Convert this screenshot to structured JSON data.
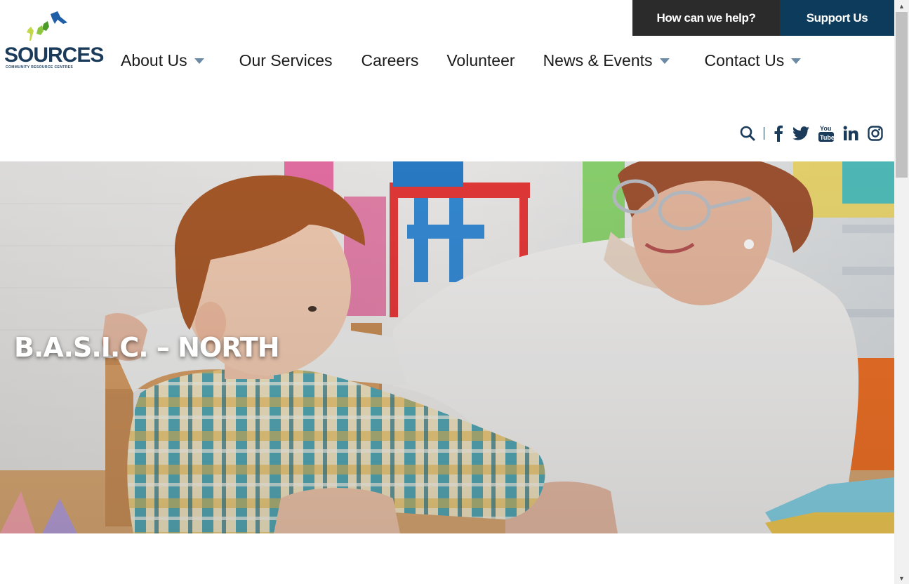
{
  "brand": {
    "name": "SOURCES",
    "tagline": "COMMUNITY RESOURCE CENTRES",
    "color_primary": "#1b3b5a",
    "color_green": "#8cc63f",
    "color_blue": "#1f5fa8"
  },
  "top_actions": {
    "help_label": "How can we help?",
    "help_bg": "#2b2b2b",
    "support_label": "Support Us",
    "support_bg": "#0d3b5c"
  },
  "nav": {
    "items": [
      {
        "label": "About Us",
        "has_dropdown": true
      },
      {
        "label": "Our Services",
        "has_dropdown": false
      },
      {
        "label": "Careers",
        "has_dropdown": false
      },
      {
        "label": "Volunteer",
        "has_dropdown": false
      },
      {
        "label": "News & Events",
        "has_dropdown": true
      },
      {
        "label": "Contact Us",
        "has_dropdown": true
      }
    ]
  },
  "social": {
    "icons": [
      "search-icon",
      "facebook-icon",
      "twitter-icon",
      "youtube-icon",
      "linkedin-icon",
      "instagram-icon"
    ],
    "color": "#1b3b5a"
  },
  "hero": {
    "title": "B.A.S.I.C. – NORTH",
    "image_desc_icon": "photo-boy-and-woman-at-table"
  }
}
